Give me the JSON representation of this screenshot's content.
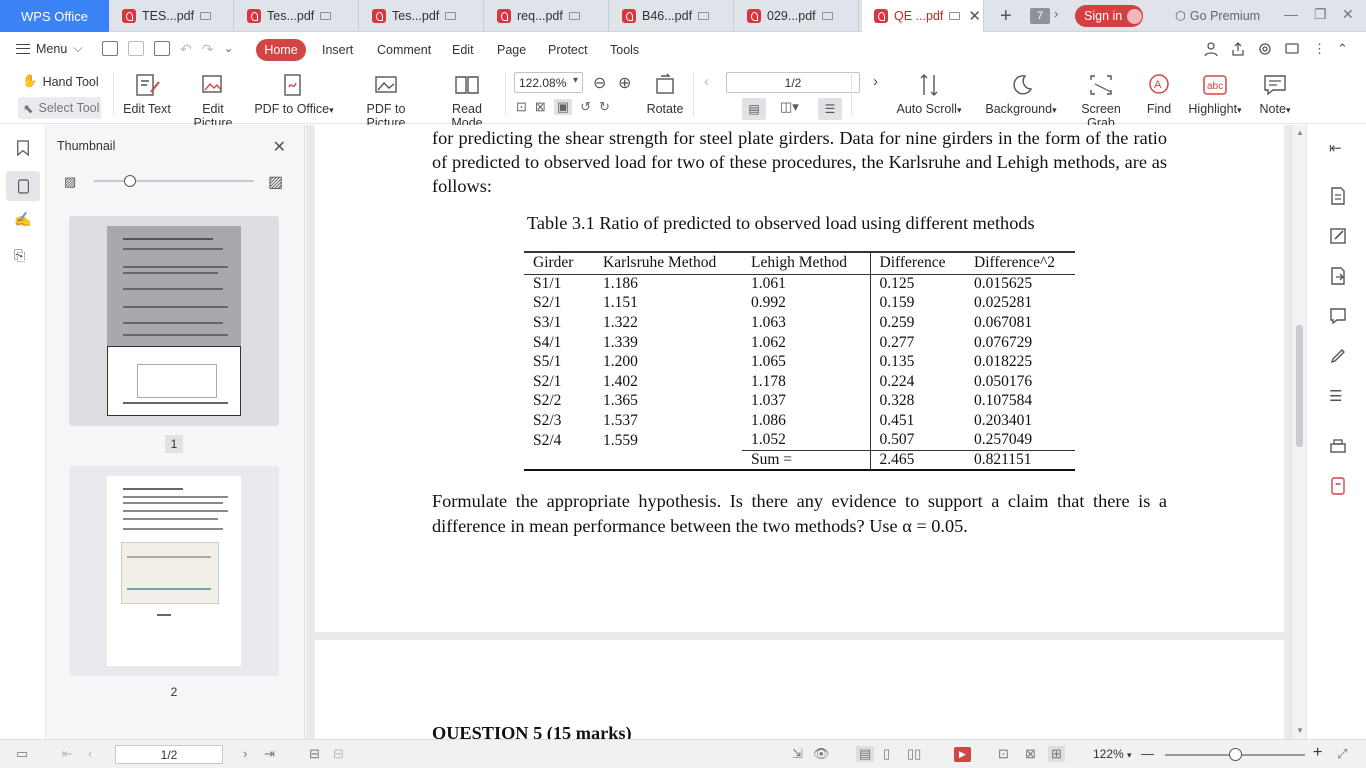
{
  "tabs": {
    "home": "WPS Office",
    "docs": [
      {
        "label": "TES...pdf"
      },
      {
        "label": "Tes...pdf"
      },
      {
        "label": "Tes...pdf"
      },
      {
        "label": "req...pdf"
      },
      {
        "label": "B46...pdf"
      },
      {
        "label": "029...pdf"
      },
      {
        "label": "QE ...pdf"
      }
    ],
    "count": "7",
    "signin": "Sign in",
    "premium": "Go Premium"
  },
  "menubar": {
    "menu": "Menu",
    "items": [
      "Home",
      "Insert",
      "Comment",
      "Edit",
      "Page",
      "Protect",
      "Tools"
    ]
  },
  "ribbon": {
    "hand_tool": "Hand Tool",
    "select_tool": "Select Tool",
    "edit_text": "Edit Text",
    "edit_picture": "Edit Picture",
    "pdf_to_office": "PDF to Office",
    "pdf_to_picture": "PDF to Picture",
    "read_mode": "Read Mode",
    "zoom": "122.08%",
    "rotate": "Rotate",
    "page": "1/2",
    "auto_scroll": "Auto Scroll",
    "background": "Background",
    "screen_grab": "Screen Grab",
    "find": "Find",
    "highlight": "Highlight",
    "note": "Note"
  },
  "sidebar": {
    "title": "Thumbnail",
    "pages": [
      "1",
      "2"
    ]
  },
  "document": {
    "intro": "for predicting the shear strength for steel plate girders. Data for nine girders in the form of the ratio of predicted to observed load for two of these procedures, the Karlsruhe and Lehigh methods, are as follows:",
    "table_caption": "Table 3.1 Ratio of predicted to observed load using different methods",
    "table": {
      "headers": [
        "Girder",
        "Karlsruhe Method",
        "Lehigh Method",
        "Difference",
        "Difference^2"
      ],
      "rows": [
        [
          "S1/1",
          "1.186",
          "1.061",
          "0.125",
          "0.015625"
        ],
        [
          "S2/1",
          "1.151",
          "0.992",
          "0.159",
          "0.025281"
        ],
        [
          "S3/1",
          "1.322",
          "1.063",
          "0.259",
          "0.067081"
        ],
        [
          "S4/1",
          "1.339",
          "1.062",
          "0.277",
          "0.076729"
        ],
        [
          "S5/1",
          "1.200",
          "1.065",
          "0.135",
          "0.018225"
        ],
        [
          "S2/1",
          "1.402",
          "1.178",
          "0.224",
          "0.050176"
        ],
        [
          "S2/2",
          "1.365",
          "1.037",
          "0.328",
          "0.107584"
        ],
        [
          "S2/3",
          "1.537",
          "1.086",
          "0.451",
          "0.203401"
        ],
        [
          "S2/4",
          "1.559",
          "1.052",
          "0.507",
          "0.257049"
        ]
      ],
      "sum_label": "Sum =",
      "sum_diff": "2.465",
      "sum_diff2": "0.821151"
    },
    "outro": "Formulate the appropriate hypothesis. Is there any evidence to support a claim that there is a difference in mean performance between the two methods? Use α = 0.05.",
    "next_heading": "QUESTION 5 (15 marks)"
  },
  "statusbar": {
    "page": "1/2",
    "zoom": "122%"
  }
}
